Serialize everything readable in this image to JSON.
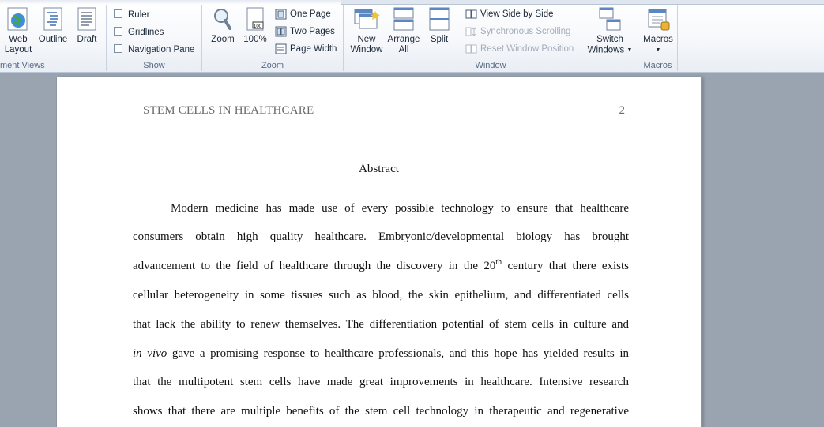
{
  "ribbon": {
    "document_views": {
      "label": "ment Views",
      "web_layout": [
        "Web",
        "Layout"
      ],
      "outline": "Outline",
      "draft": "Draft"
    },
    "show": {
      "label": "Show",
      "ruler": "Ruler",
      "gridlines": "Gridlines",
      "navigation_pane": "Navigation Pane"
    },
    "zoom": {
      "label": "Zoom",
      "zoom": "Zoom",
      "hundred": "100%",
      "one_page": "One Page",
      "two_pages": "Two Pages",
      "page_width": "Page Width"
    },
    "window": {
      "label": "Window",
      "new_window": [
        "New",
        "Window"
      ],
      "arrange_all": [
        "Arrange",
        "All"
      ],
      "split": "Split",
      "view_side_by_side": "View Side by Side",
      "synchronous_scrolling": "Synchronous Scrolling",
      "reset_window_position": "Reset Window Position",
      "switch_windows": [
        "Switch",
        "Windows"
      ]
    },
    "macros": {
      "label": "Macros",
      "macros": "Macros"
    }
  },
  "document": {
    "running_head": "STEM CELLS IN HEALTHCARE",
    "page_number": "2",
    "heading": "Abstract",
    "lines": [
      {
        "pre": "Modern medicine has made use of every possible technology to ensure that healthcare"
      },
      {
        "pre": "consumers obtain high quality healthcare. Embryonic/developmental biology has brought"
      },
      {
        "pre": "advancement to the field of healthcare through the discovery in the 20",
        "sup": "th",
        "post": " century that there exists"
      },
      {
        "pre": "cellular heterogeneity in some tissues such as blood, the skin epithelium, and differentiated cells"
      },
      {
        "pre": "that lack the ability to renew themselves. The differentiation potential of stem cells in culture and"
      },
      {
        "em": "in vivo",
        "post": " gave a promising response to healthcare professionals, and this hope has yielded results in"
      },
      {
        "pre": "that the multipotent stem cells have made great improvements in healthcare. Intensive research"
      },
      {
        "pre": "shows that there are multiple benefits of the stem cell technology in therapeutic and regenerative"
      }
    ]
  }
}
